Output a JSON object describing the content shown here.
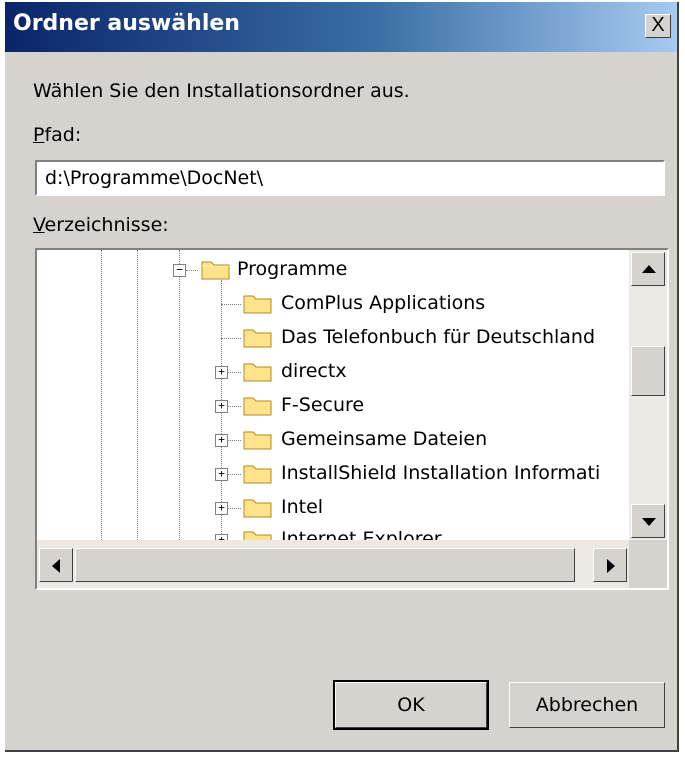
{
  "dialog": {
    "title": "Ordner auswählen",
    "close_label": "X",
    "instruction": "Wählen Sie den Installationsordner aus.",
    "path_label": "Pfad:",
    "path_value": "d:\\Programme\\DocNet\\",
    "dirs_label": "Verzeichnisse:",
    "ok_label": "OK",
    "cancel_label": "Abbrechen"
  },
  "tree": {
    "items": [
      {
        "label": "Programme",
        "expander": "−"
      },
      {
        "label": "ComPlus Applications",
        "expander": ""
      },
      {
        "label": "Das Telefonbuch für Deutschland",
        "expander": ""
      },
      {
        "label": "directx",
        "expander": "+"
      },
      {
        "label": "F-Secure",
        "expander": "+"
      },
      {
        "label": "Gemeinsame Dateien",
        "expander": "+"
      },
      {
        "label": "InstallShield Installation Informati",
        "expander": "+"
      },
      {
        "label": "Intel",
        "expander": "+"
      },
      {
        "label": "Internet Explorer",
        "expander": "+"
      }
    ]
  },
  "colors": {
    "title_start": "#0a246a",
    "title_end": "#a6caf0",
    "dialog_bg": "#d6d3ce",
    "folder_fill": "#ffe38a"
  }
}
